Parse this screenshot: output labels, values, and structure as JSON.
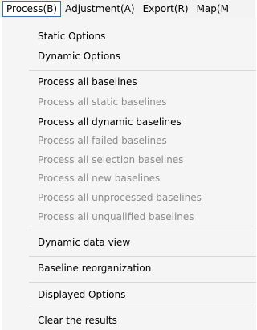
{
  "menubar": {
    "items": [
      "Process(B)",
      "Adjustment(A)",
      "Export(R)",
      "Map(M"
    ]
  },
  "dropdown": {
    "items": [
      {
        "label": "Static Options",
        "enabled": true
      },
      {
        "label": "Dynamic Options",
        "enabled": true
      },
      {
        "label": "Process all baselines",
        "enabled": true
      },
      {
        "label": "Process all static baselines",
        "enabled": false
      },
      {
        "label": "Process all dynamic baselines",
        "enabled": true
      },
      {
        "label": "Process all failed baselines",
        "enabled": false
      },
      {
        "label": "Process all selection baselines",
        "enabled": false
      },
      {
        "label": "Process all new baselines",
        "enabled": false
      },
      {
        "label": "Process all unprocessed baselines",
        "enabled": false
      },
      {
        "label": "Process all unqualified baselines",
        "enabled": false
      },
      {
        "label": "Dynamic data view",
        "enabled": true
      },
      {
        "label": "Baseline reorganization",
        "enabled": true
      },
      {
        "label": "Displayed Options",
        "enabled": true
      },
      {
        "label": "Clear the results",
        "enabled": true
      }
    ]
  }
}
